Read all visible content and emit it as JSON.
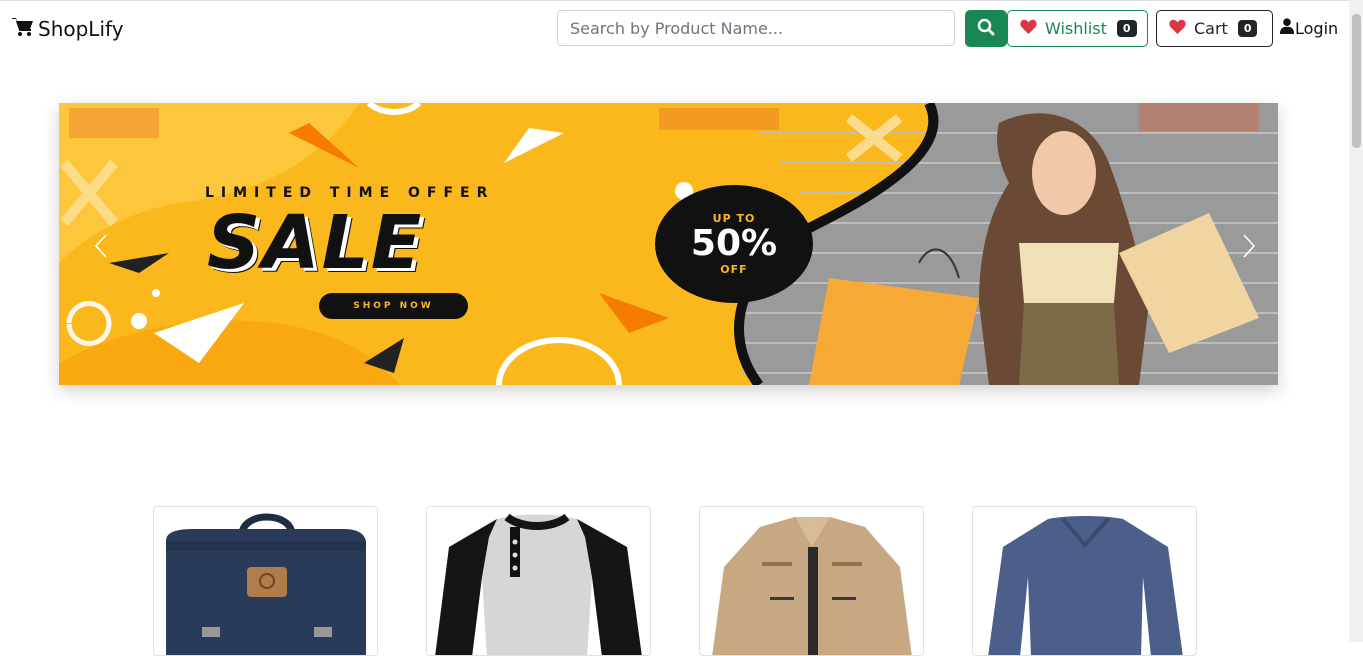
{
  "nav": {
    "brand": "ShopLify",
    "brand_icon": "cart-icon",
    "search_placeholder": "Search by Product Name...",
    "search_icon": "search-icon",
    "wishlist_label": "Wishlist",
    "wishlist_count": "0",
    "cart_label": "Cart",
    "cart_count": "0",
    "heart_icon": "heart-icon",
    "login_label": "Login",
    "login_icon": "user-icon",
    "colors": {
      "primary": "#198754",
      "heart": "#dc3545",
      "dark": "#212529"
    }
  },
  "carousel": {
    "slide": {
      "headline": "LIMITED TIME OFFER",
      "title": "SALE",
      "cta": "SHOP NOW",
      "discount_top": "UP TO",
      "discount": "50%",
      "discount_bottom": "OFF"
    },
    "colors": {
      "background": "#fbb81d",
      "accent": "#f57c00"
    }
  },
  "products": [
    {
      "name": "backpack"
    },
    {
      "name": "raglan-henley-tshirt"
    },
    {
      "name": "khaki-jacket"
    },
    {
      "name": "blue-vneck-sweater"
    }
  ]
}
